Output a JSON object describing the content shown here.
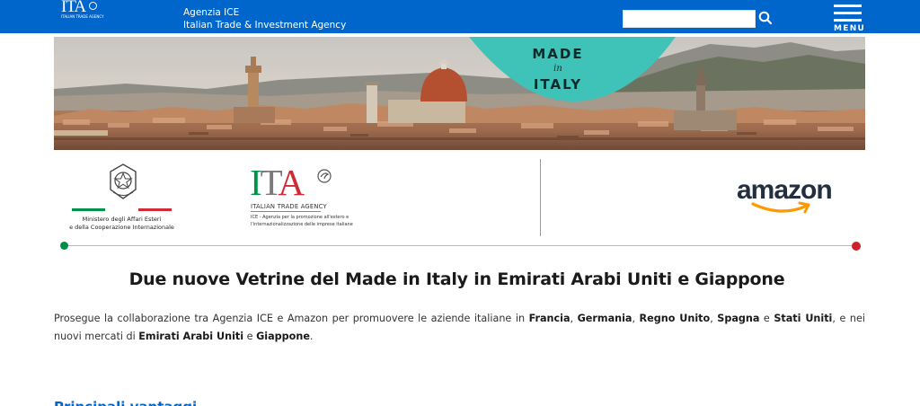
{
  "header": {
    "logo_text": "ITA",
    "logo_subtext": "ITALIAN TRADE AGENCY",
    "agency_line1": "Agenzia ICE",
    "agency_line2": "Italian Trade & Investment Agency",
    "search_placeholder": "",
    "search_icon": "search-icon",
    "menu_label": "MENU",
    "menu_icon": "hamburger-icon"
  },
  "hero": {
    "badge_line1": "MADE",
    "badge_line2": "in",
    "badge_line3": "ITALY"
  },
  "partners": {
    "ministry_line1": "Ministero degli Affari Esteri",
    "ministry_line2": "e della Cooperazione Internazionale",
    "ita_letter_i": "I",
    "ita_letter_t": "T",
    "ita_letter_a": "A",
    "ita_name": "ITALIAN TRADE AGENCY",
    "ita_desc": "ICE - Agenzia per la promozione all'estero e l'internazionalizzazione delle imprese italiane",
    "amazon_word": "amazon"
  },
  "article": {
    "headline": "Due nuove Vetrine del Made in Italy in Emirati Arabi Uniti e Giappone",
    "intro_1": "Prosegue la collaborazione tra Agenzia ICE e Amazon per promuovere le aziende italiane in ",
    "country_1": "Francia",
    "sep_1": ", ",
    "country_2": "Germania",
    "sep_2": ", ",
    "country_3": "Regno Unito",
    "sep_3": ", ",
    "country_4": "Spagna",
    "sep_4": " e ",
    "country_5": "Stati Uniti",
    "intro_2": ", e nei nuovi mercati di ",
    "country_6": "Emirati Arabi Uniti",
    "sep_5": " e ",
    "country_7": "Giappone",
    "end": ".",
    "section_heading": "Principali vantaggi"
  },
  "colors": {
    "brand_blue": "#0066cc",
    "italy_green": "#009246",
    "italy_red": "#ce2b37",
    "badge_teal": "#3fc3b8"
  }
}
